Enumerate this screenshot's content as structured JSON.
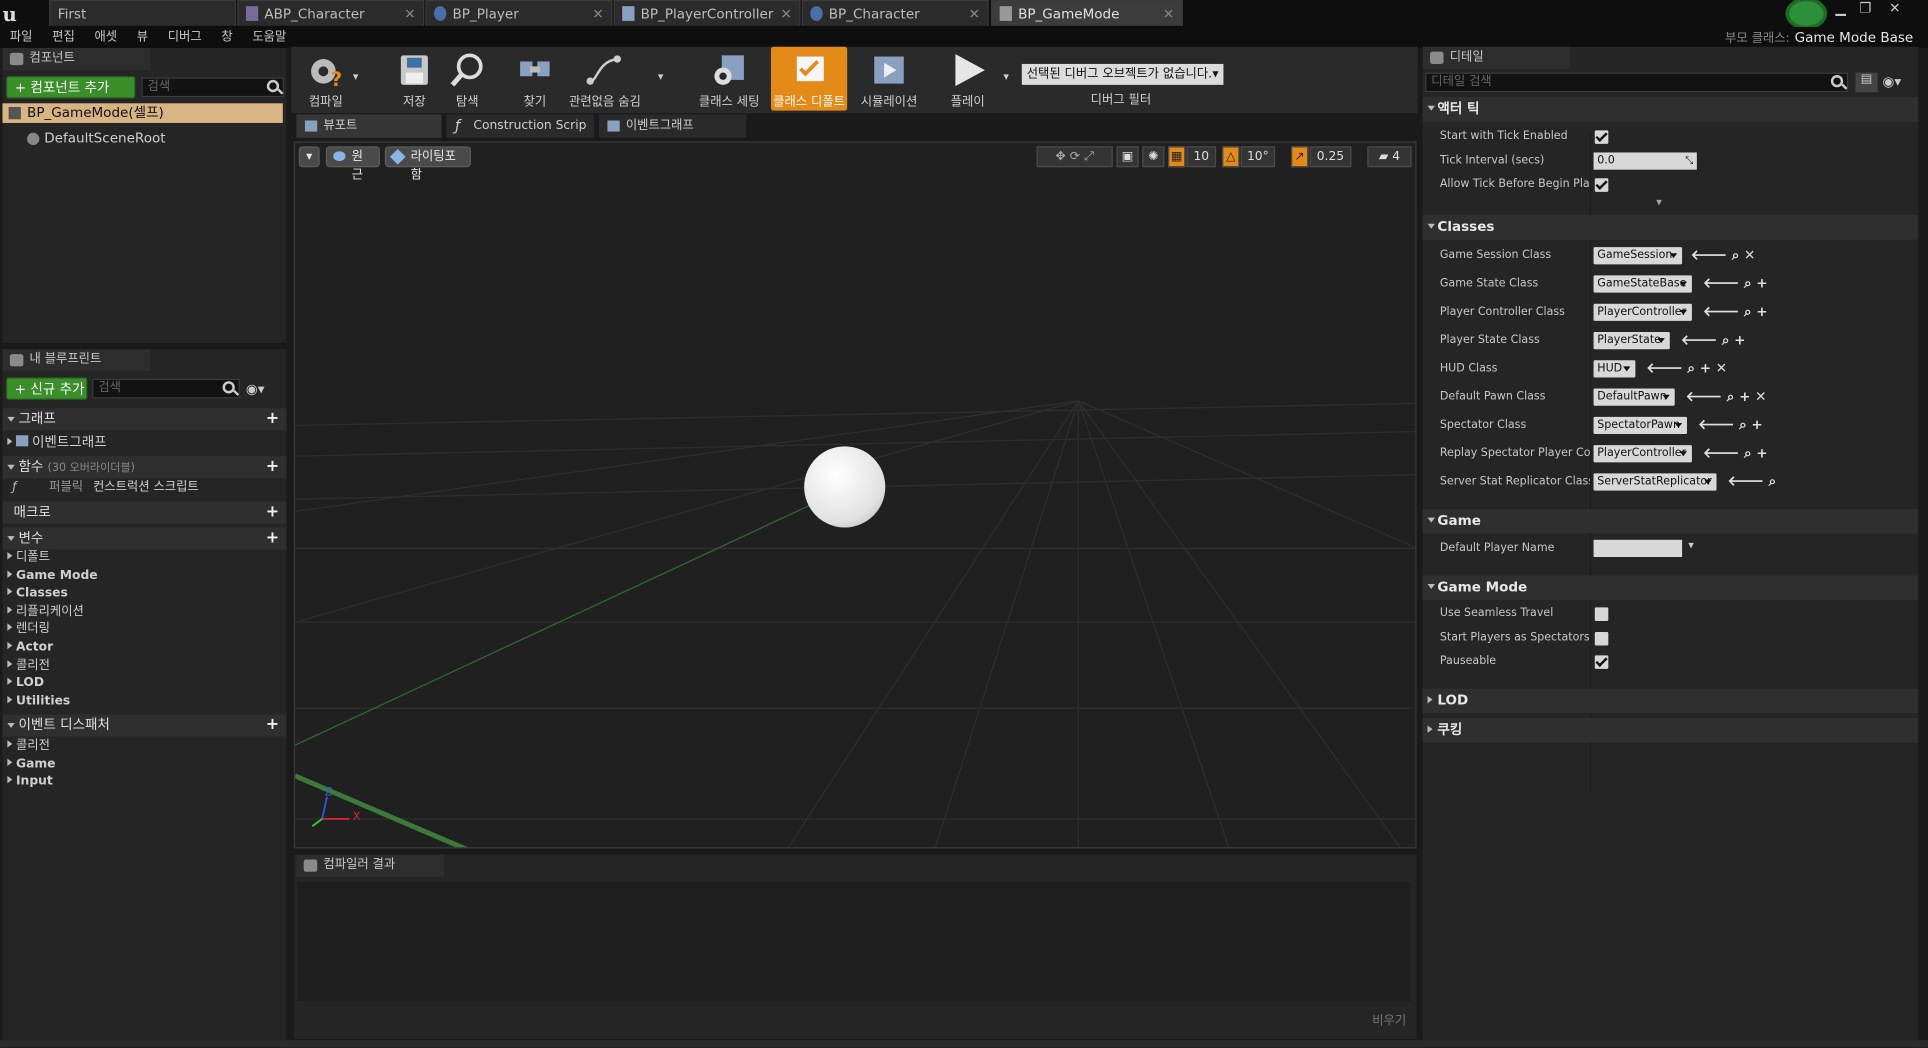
{
  "app": {
    "logo": "u"
  },
  "tabs": [
    {
      "label": "First",
      "icon": "level-icon"
    },
    {
      "label": "ABP_Character",
      "icon": "anim-blueprint-icon"
    },
    {
      "label": "BP_Player",
      "icon": "blueprint-icon"
    },
    {
      "label": "BP_PlayerController",
      "icon": "controller-icon"
    },
    {
      "label": "BP_Character",
      "icon": "blueprint-icon"
    },
    {
      "label": "BP_GameMode",
      "icon": "gamemode-icon"
    }
  ],
  "menu": [
    "파일",
    "편집",
    "애셋",
    "뷰",
    "디버그",
    "창",
    "도움말"
  ],
  "parent_class": {
    "label": "부모 클래스:",
    "value": "Game Mode Base"
  },
  "components": {
    "tab": "컴포넌트",
    "add_button": "+ 컴포넌트 추가",
    "search_placeholder": "검색",
    "root_item": "BP_GameMode(셀프)",
    "child_item": "DefaultSceneRoot"
  },
  "my_blueprint": {
    "tab": "내 블루프린트",
    "add_button": "+ 신규 추가",
    "search_placeholder": "검색",
    "graph_section": "그래프",
    "graph_item": "이벤트그래프",
    "functions_section": "함수",
    "functions_count": "(30 오버라이더블)",
    "function_item_access": "퍼블릭",
    "function_item": "컨스트럭션 스크립트",
    "macros_section": "매크로",
    "variables_section": "변수",
    "variable_groups": [
      "디폴트",
      "Game Mode",
      "Classes",
      "리플리케이션",
      "렌더링",
      "Actor",
      "콜리전",
      "LOD",
      "Utilities"
    ],
    "dispatchers_section": "이벤트 디스패처",
    "dispatcher_groups": [
      "콜리전",
      "Game",
      "Input"
    ]
  },
  "toolbar": {
    "compile": "컴파일",
    "save": "저장",
    "browse": "탐색",
    "find": "찾기",
    "hide_unrelated": "관련없음 숨김",
    "class_settings": "클래스 세팅",
    "class_defaults": "클래스 디폴트",
    "simulation": "시뮬레이션",
    "play": "플레이",
    "debug_select": "선택된 디버그 오브젝트가 없습니다.",
    "debug_filter": "디버그 필터"
  },
  "editor_tabs": [
    "뷰포트",
    "Construction Scrip",
    "이벤트그래프"
  ],
  "viewport": {
    "perspective": "원근",
    "lighting": "라이팅포함",
    "grid_snap": "10",
    "rot_snap": "10°",
    "scale_snap": "0.25",
    "cam_speed": "4",
    "axis_x": "X",
    "axis_y": "Y",
    "axis_z": "Z"
  },
  "compiler": {
    "tab": "컴파일러 결과",
    "clear": "비우기"
  },
  "details": {
    "tab": "디테일",
    "search_placeholder": "디테일 검색",
    "actor_tick": {
      "title": "액터 틱",
      "start_with_tick": "Start with Tick Enabled",
      "tick_interval": "Tick Interval (secs)",
      "tick_interval_value": "0.0",
      "allow_tick": "Allow Tick Before Begin Play"
    },
    "classes": {
      "title": "Classes",
      "rows": [
        {
          "label": "Game Session Class",
          "value": "GameSession",
          "icons": [
            "arrow-left-icon",
            "search-icon",
            "clear-icon"
          ]
        },
        {
          "label": "Game State Class",
          "value": "GameStateBase",
          "icons": [
            "arrow-left-icon",
            "search-icon",
            "add-icon"
          ]
        },
        {
          "label": "Player Controller Class",
          "value": "PlayerController",
          "icons": [
            "arrow-left-icon",
            "search-icon",
            "add-icon"
          ]
        },
        {
          "label": "Player State Class",
          "value": "PlayerState",
          "icons": [
            "arrow-left-icon",
            "search-icon",
            "add-icon"
          ]
        },
        {
          "label": "HUD Class",
          "value": "HUD",
          "icons": [
            "arrow-left-icon",
            "search-icon",
            "add-icon",
            "clear-icon"
          ]
        },
        {
          "label": "Default Pawn Class",
          "value": "DefaultPawn",
          "icons": [
            "arrow-left-icon",
            "search-icon",
            "add-icon",
            "clear-icon"
          ]
        },
        {
          "label": "Spectator Class",
          "value": "SpectatorPawn",
          "icons": [
            "arrow-left-icon",
            "search-icon",
            "add-icon"
          ]
        },
        {
          "label": "Replay Spectator Player Contr",
          "value": "PlayerController",
          "icons": [
            "arrow-left-icon",
            "search-icon",
            "add-icon"
          ]
        },
        {
          "label": "Server Stat Replicator Class",
          "value": "ServerStatReplicator",
          "icons": [
            "arrow-left-icon",
            "search-icon"
          ]
        }
      ]
    },
    "game": {
      "title": "Game",
      "default_player_name": "Default Player Name",
      "default_player_value": ""
    },
    "game_mode": {
      "title": "Game Mode",
      "use_seamless": "Use Seamless Travel",
      "start_spectators": "Start Players as Spectators",
      "pauseable": "Pauseable"
    },
    "lod": "LOD",
    "cooking": "쿠킹"
  },
  "colors": {
    "accent": "#e38a19",
    "green": "#3a8f2a",
    "selection": "#d9b483"
  }
}
